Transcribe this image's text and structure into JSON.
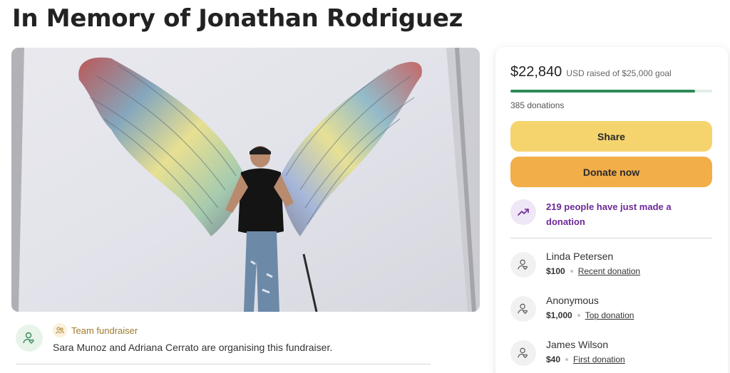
{
  "page": {
    "title": "In Memory of Jonathan Rodriguez"
  },
  "organiser": {
    "badge": "Team fundraiser",
    "text": "Sara Munoz and Adriana Cerrato are organising this fundraiser."
  },
  "donation_card": {
    "amount": "$22,840",
    "goal_text": "USD raised of $25,000 goal",
    "progress_fraction": 0.9136,
    "donations_count": "385 donations",
    "share_label": "Share",
    "donate_label": "Donate now",
    "trend_text": "219 people have just made a donation",
    "donors": [
      {
        "name": "Linda Petersen",
        "amount": "$100",
        "tag": "Recent donation"
      },
      {
        "name": "Anonymous",
        "amount": "$1,000",
        "tag": "Top donation"
      },
      {
        "name": "James Wilson",
        "amount": "$40",
        "tag": "First donation"
      }
    ]
  },
  "colors": {
    "progress": "#2e8b57",
    "share_button": "#f5d46e",
    "donate_button": "#f2ae49",
    "trend_text": "#6d2a98"
  },
  "icons": {
    "organiser_avatar": "user-heart-icon",
    "team": "team-icon",
    "trend": "trending-up-icon",
    "donor": "donor-heart-icon"
  }
}
